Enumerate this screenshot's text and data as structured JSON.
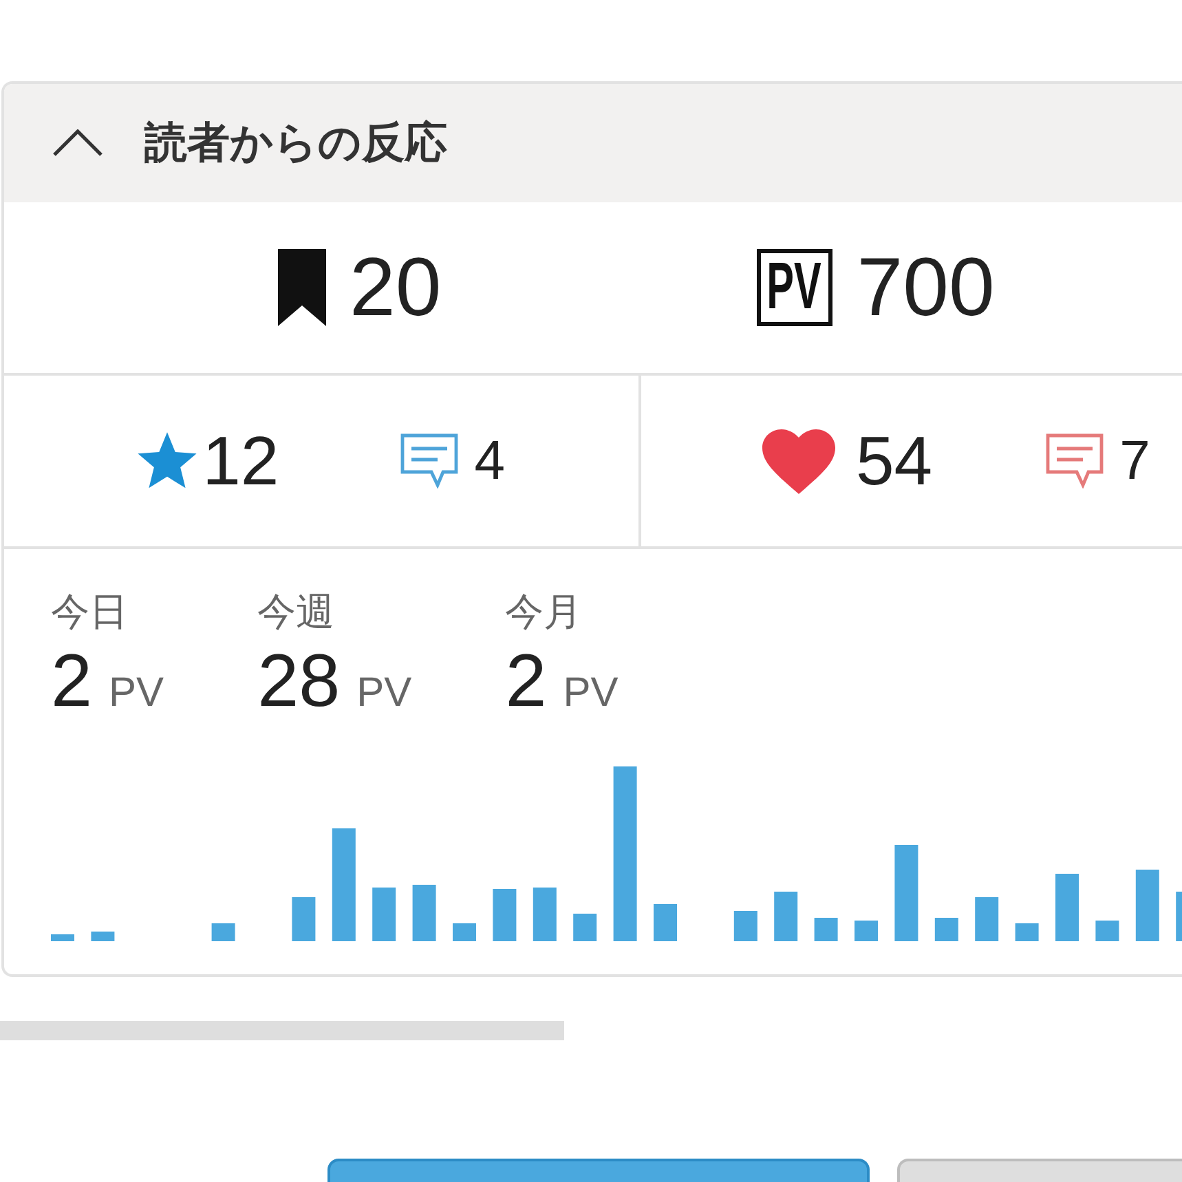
{
  "panel": {
    "title": "読者からの反応",
    "expanded": true,
    "totals": [
      {
        "kind": "bookmark",
        "value": "20"
      },
      {
        "kind": "pageview",
        "icon_label": "PV",
        "value": "700"
      }
    ],
    "reactions": [
      {
        "kind": "star",
        "count": "12",
        "comments": "4"
      },
      {
        "kind": "heart",
        "count": "54",
        "comments": "7"
      }
    ],
    "periods": [
      {
        "label": "今日",
        "value": "2",
        "unit": "PV"
      },
      {
        "label": "今週",
        "value": "28",
        "unit": "PV"
      },
      {
        "label": "今月",
        "value": "2",
        "unit": "PV"
      }
    ]
  },
  "footer": {
    "buttons": [
      {
        "kind": "primary"
      },
      {
        "kind": "secondary"
      }
    ]
  }
}
